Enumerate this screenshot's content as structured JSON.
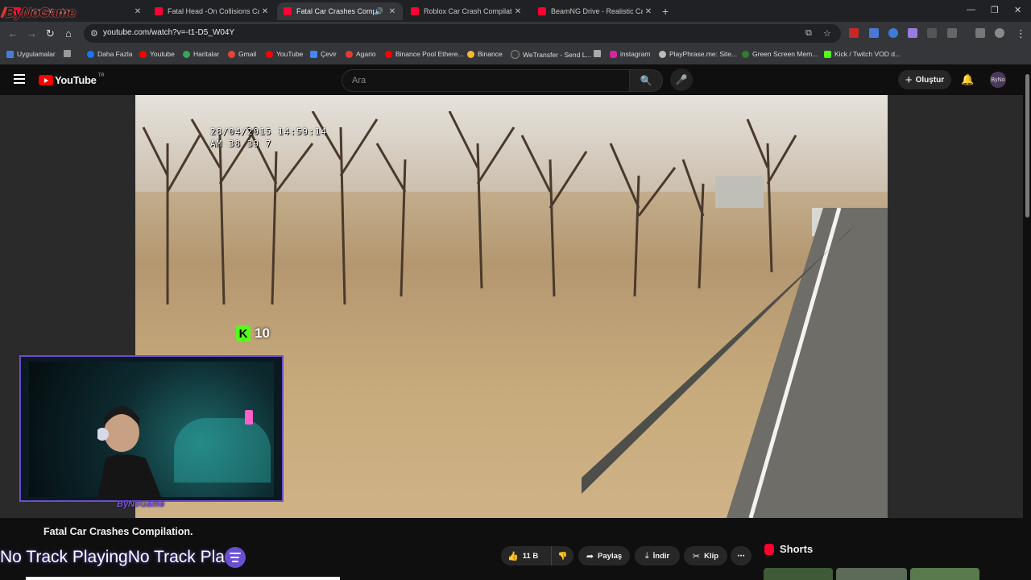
{
  "browser": {
    "tabs": [
      {
        "title": "Fatal Head -On Collisions Caug",
        "active": false
      },
      {
        "title": "Fatal Car Crashes Compilati",
        "active": true
      },
      {
        "title": "Roblox Car Crash Compilation",
        "active": false
      },
      {
        "title": "BeamNG Drive - Realistic Car C",
        "active": false
      }
    ],
    "first_tab_partial": "...ri t... Yo ube",
    "overlay_logo": "ByNoGame",
    "url": "youtube.com/watch?v=-t1-D5_W04Y",
    "bookmarks": [
      "Uygulamalar",
      "Daha Fazla",
      "Youtube",
      "Haritalar",
      "Gmail",
      "YouTube",
      "Çevir",
      "Agario",
      "Binance Pool Ethere...",
      "Binance",
      "WeTransfer - Send L...",
      "instagram",
      "PlayPhrase.me: Site...",
      "Green Screen Mem...",
      "Kick / Twitch VOD d..."
    ]
  },
  "youtube": {
    "logo_text": "YouTube",
    "country": "TR",
    "search_placeholder": "Ara",
    "create_label": "Oluştur",
    "avatar_text": "ByNo"
  },
  "video": {
    "osd_date": "28/04/2015 14:59:14",
    "osd_line2": "AM 38 39 7",
    "kick_count": "10",
    "webcam_label": "ByNoGame",
    "title": "Fatal Car Crashes Compilation."
  },
  "actions": {
    "likes": "11 B",
    "share": "Paylaş",
    "download": "İndir",
    "clip": "Klip"
  },
  "shorts_label": "Shorts",
  "ticker_text": "No Track PlayingNo Track Pla",
  "colors": {
    "yt_red": "#ff0000",
    "kick_green": "#53fc18",
    "stream_purple": "#6a4fd0"
  }
}
